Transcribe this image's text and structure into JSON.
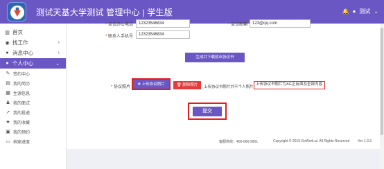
{
  "header": {
    "title": "测试天基大学测试 管理中心 | 学生版",
    "user": "测试",
    "bell_icon": "bell-icon",
    "user_icon": "user-icon"
  },
  "sidebar": {
    "items": [
      {
        "label": "首页",
        "icon": "bank-icon",
        "arrow": ""
      },
      {
        "label": "找工作",
        "icon": "eye-icon",
        "arrow": "›"
      },
      {
        "label": "消息中心",
        "icon": "chat-icon",
        "arrow": "›"
      },
      {
        "label": "个人中心",
        "icon": "user-icon",
        "arrow": "⌄"
      }
    ],
    "sub_items": [
      {
        "label": "签约中心",
        "icon": "edit-icon"
      },
      {
        "label": "我的简历",
        "icon": "resume-icon"
      },
      {
        "label": "生源信息",
        "icon": "grid-icon"
      },
      {
        "label": "我的面试",
        "icon": "group-icon"
      },
      {
        "label": "我的投递",
        "icon": "send-icon"
      },
      {
        "label": "我的收藏",
        "icon": "star-icon"
      },
      {
        "label": "我的预约",
        "icon": "calendar-icon"
      },
      {
        "label": "档案进度",
        "icon": "doc-icon"
      }
    ]
  },
  "form": {
    "office_phone_label": "单位办公电话",
    "office_phone_value": "12323546834",
    "postal_label": "单位邮箱",
    "postal_value": "123@qq.com",
    "contact_phone_label": "联系人手机号",
    "contact_phone_value": "12323546834",
    "generate_button": "生成并下载就业协议书",
    "agreement_label": "协议照片",
    "upload_button": "上传协议照片",
    "delete_button": "删除照片",
    "upload_hint": "上传协议书照片并不个人照片:",
    "file_name": "上传协议书照片为AG正反面及全部内容",
    "submit_button": "提交"
  },
  "footer": {
    "hotline": "客服热线：400-666-9901",
    "copyright": "Copyright © 2019 GoWork.ai. All Rights Reserved",
    "version": "Ver 1.3.3"
  },
  "colors": {
    "accent": "#6b57c4",
    "highlight": "#e01e1e"
  }
}
